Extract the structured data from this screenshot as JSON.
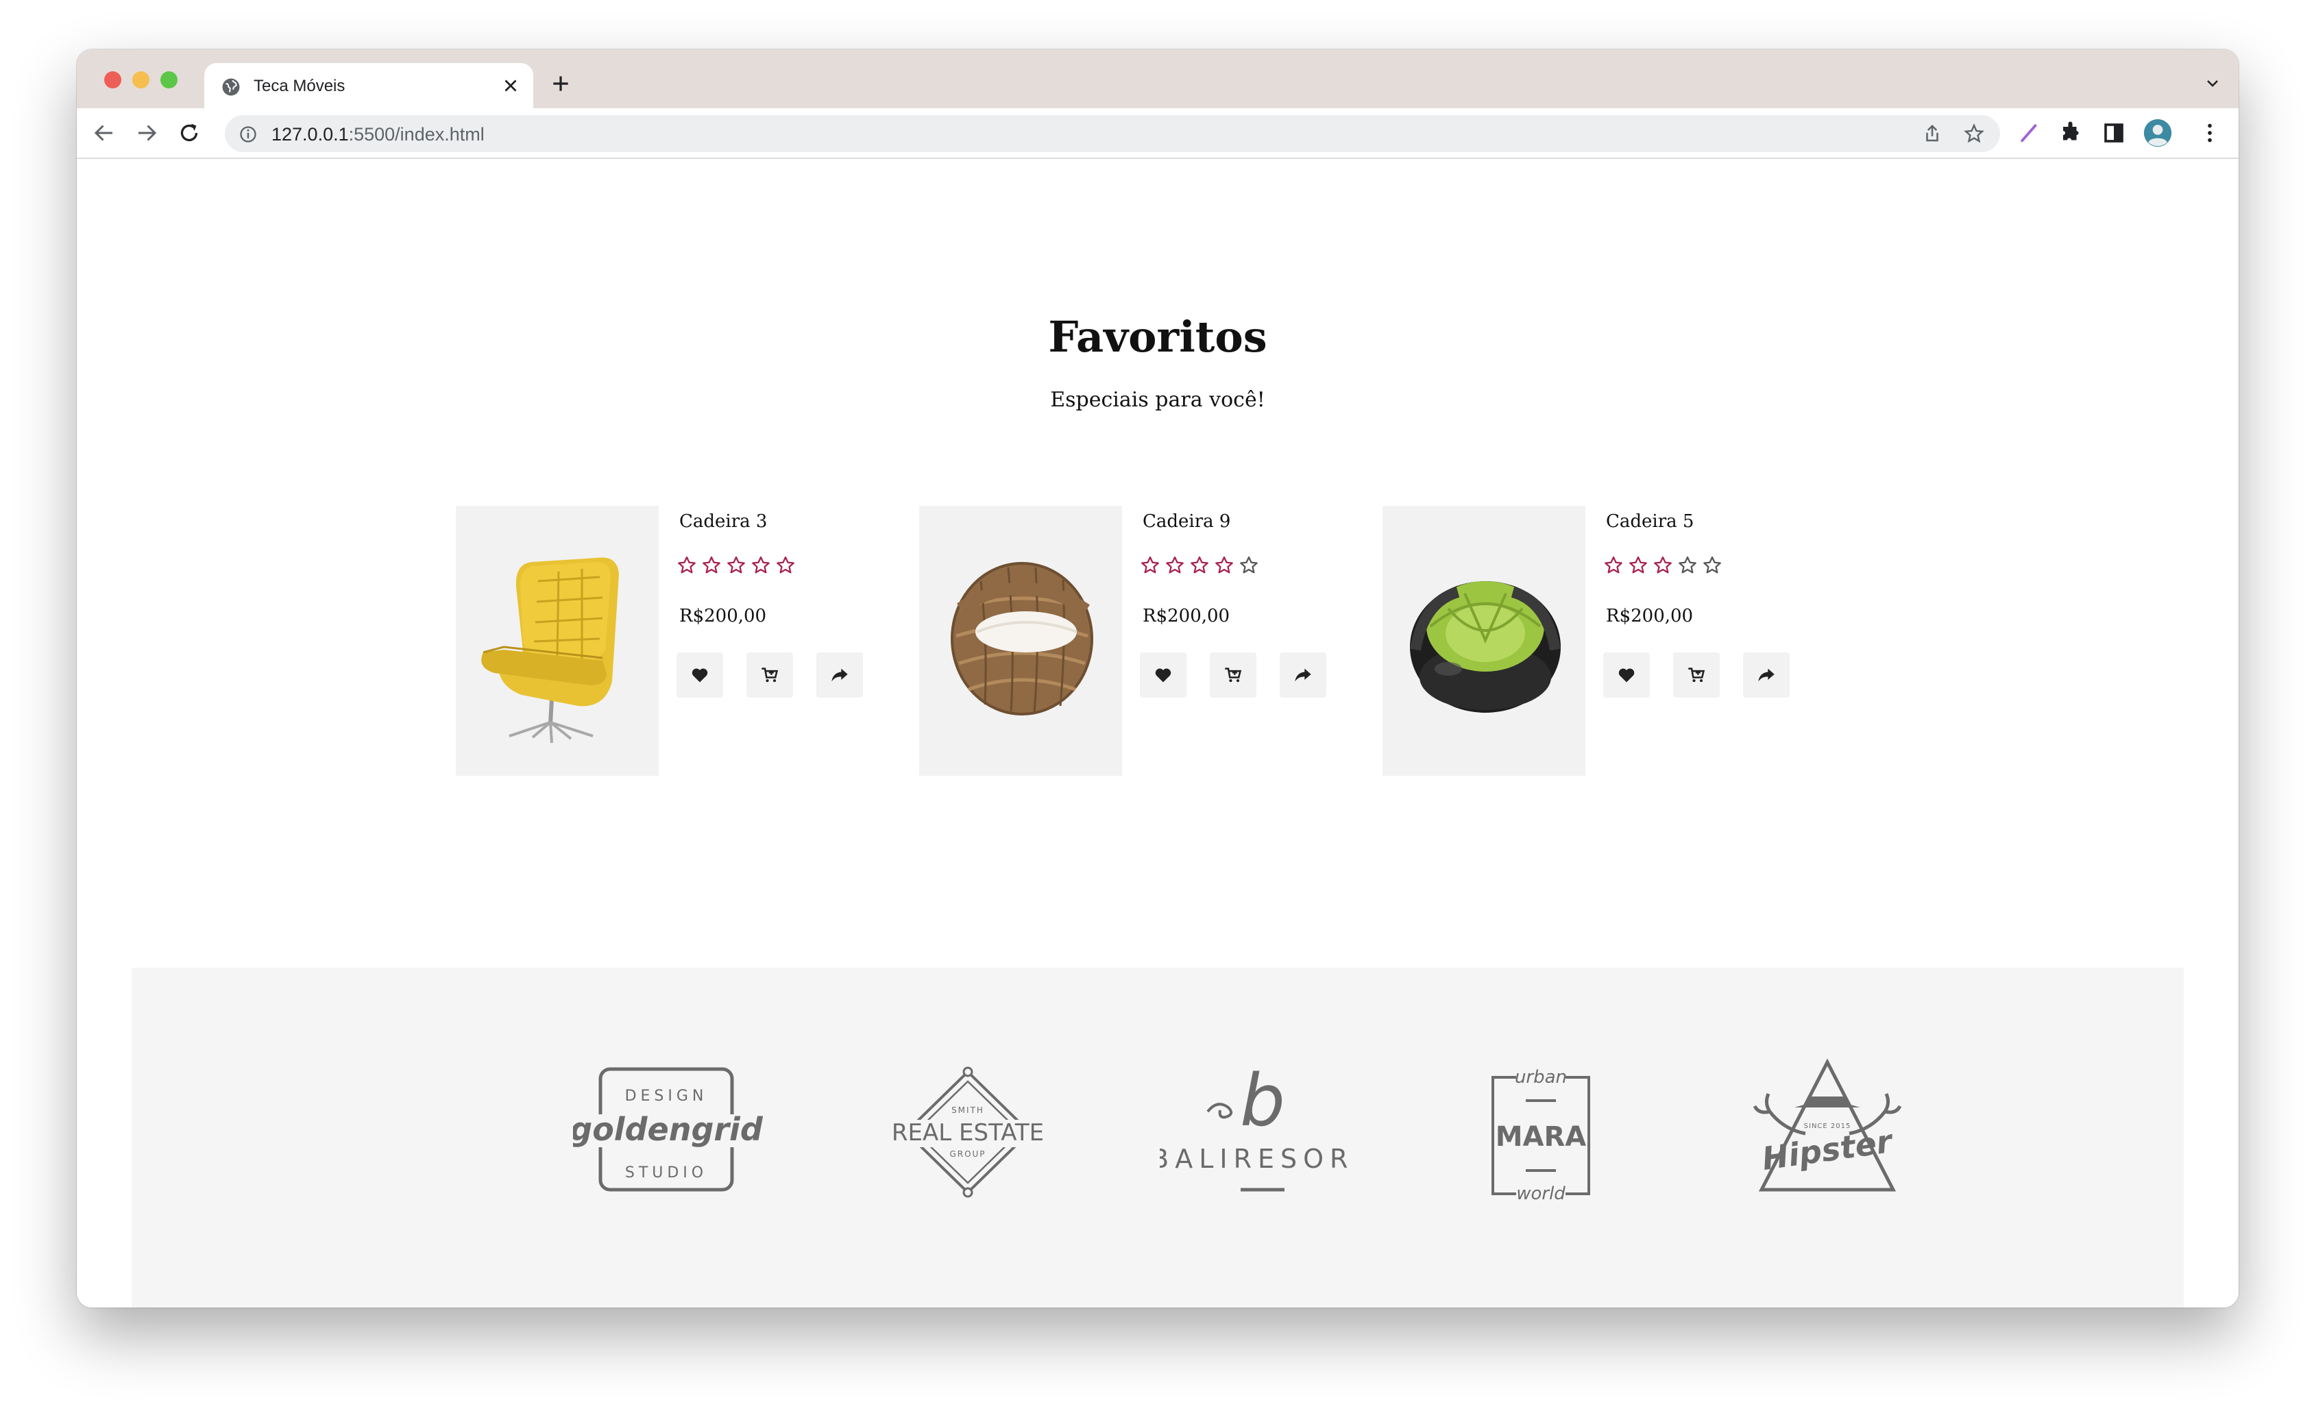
{
  "browser": {
    "tab_title": "Teca Móveis",
    "url_host": "127.0.0.1",
    "url_rest": ":5500/index.html"
  },
  "section": {
    "title": "Favoritos",
    "subtitle": "Especiais para você!"
  },
  "products": [
    {
      "name": "Cadeira 3",
      "price": "R$200,00",
      "rating_filled": 5,
      "rating_max": 5,
      "image": "yellow-armchair"
    },
    {
      "name": "Cadeira 9",
      "price": "R$200,00",
      "rating_filled": 4,
      "rating_max": 5,
      "image": "wicker-egg-chair"
    },
    {
      "name": "Cadeira 5",
      "price": "R$200,00",
      "rating_filled": 3,
      "rating_max": 5,
      "image": "inflatable-green-chair"
    }
  ],
  "brands": {
    "goldengrid": {
      "top": "DESIGN",
      "middle": "goldengrid",
      "bottom": "STUDIO"
    },
    "realestate": {
      "top": "SMITH",
      "middle": "REAL ESTATE",
      "bottom": "GROUP"
    },
    "baliresort": {
      "mark": "b",
      "text": "BALIRESORT"
    },
    "mara": {
      "top": "urban",
      "middle": "MARA",
      "bottom": "world"
    },
    "hipster": {
      "top": "SINCE 2015",
      "middle": "Hipster"
    }
  },
  "colors": {
    "star_filled": "#a8204e",
    "star_empty": "#555555",
    "logo_gray": "#6b6b6b"
  }
}
